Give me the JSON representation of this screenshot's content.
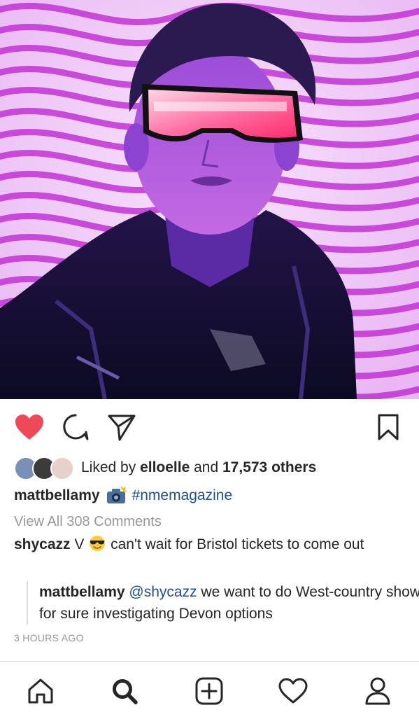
{
  "post": {
    "image_alt": "Post photo: man with rectangular visor sunglasses against purple swirl background",
    "likes": {
      "prefix": "Liked by",
      "user": "elloelle",
      "and_text": "and",
      "count": "17,573 others"
    },
    "caption": {
      "username": "mattbellamy",
      "emoji_icon": "camera-flash-emoji",
      "hashtag": "#nmemagazine"
    },
    "view_all": "View All 308 Comments",
    "comments": [
      {
        "username": "shycazz",
        "text_before_emoji": "V",
        "emoji_icon": "sunglasses-emoji",
        "text": "can't wait for Bristol tickets to come out"
      }
    ],
    "reply": {
      "username": "mattbellamy",
      "mention": "@shycazz",
      "text": "we want to do West-country show for sure investigating Devon options"
    },
    "timestamp": "3 HOURS AGO"
  },
  "colors": {
    "like_red": "#ed4956",
    "link_blue": "#1f4f8f",
    "muted": "#999999",
    "text": "#262626"
  },
  "icons": {
    "actions": [
      "heart-filled-icon",
      "comment-icon",
      "share-icon",
      "bookmark-icon"
    ],
    "tabs": [
      "home-icon",
      "search-icon",
      "add-post-icon",
      "heart-icon",
      "profile-icon"
    ]
  }
}
